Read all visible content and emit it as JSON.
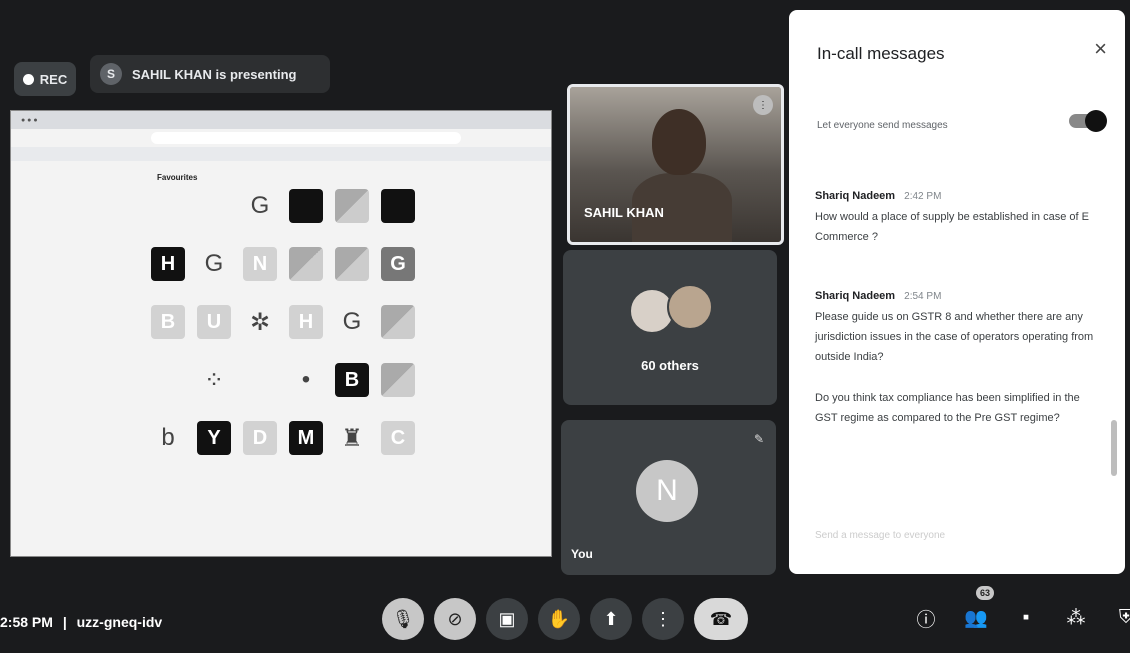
{
  "header": {
    "rec_label": "REC",
    "presenter_initial": "S",
    "presenting_text": "SAHIL KHAN is presenting"
  },
  "shared_screen": {
    "favourites_label": "Favourites",
    "rows": [
      [
        "apple",
        "apple",
        "g",
        "black",
        "gradient",
        "black"
      ],
      [
        "H",
        "g",
        "N",
        "mix",
        "mix",
        "G"
      ],
      [
        "B",
        "U",
        "spinner",
        "H",
        "g",
        "mix"
      ],
      [
        "apple",
        "dots",
        "apple",
        "dot",
        "B",
        "mix"
      ],
      [
        "b",
        "Y",
        "D",
        "M",
        "figure",
        "C"
      ]
    ]
  },
  "participants": {
    "presenter_name": "SAHIL KHAN",
    "others_label": "60 others",
    "you_initial": "N",
    "you_label": "You"
  },
  "chat": {
    "title": "In-call messages",
    "close_icon": "×",
    "toggle_label": "Let everyone send messages",
    "messages": [
      {
        "sender": "Shariq Nadeem",
        "time": "2:42 PM",
        "text": "How would a place of supply be established in case of E Commerce ?"
      },
      {
        "sender": "Shariq Nadeem",
        "time": "2:54 PM",
        "text": "Please guide us on GSTR 8 and whether there are any jurisdiction issues in the case of operators operating from outside India?"
      },
      {
        "sender": "",
        "time": "",
        "text": "Do you think tax compliance has been simplified in the GST regime as compared to the Pre GST regime?"
      }
    ],
    "input_placeholder": "Send a message to everyone"
  },
  "footer": {
    "time": "2:58 PM",
    "separator": "|",
    "meeting_code": "uzz-gneq-idv",
    "people_count": "63",
    "controls": [
      "mic-off-icon",
      "camera-off-icon",
      "captions-icon",
      "raise-hand-icon",
      "present-icon",
      "more-icon",
      "end-call-icon"
    ],
    "right_controls": [
      "info-icon",
      "people-icon",
      "chat-icon",
      "activities-icon",
      "host-controls-icon"
    ]
  }
}
